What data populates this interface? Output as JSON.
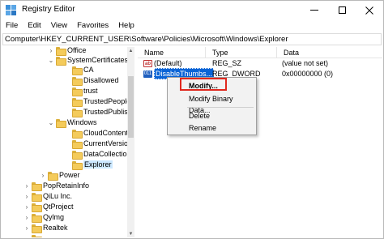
{
  "window": {
    "title": "Registry Editor",
    "icon": "registry-editor-icon"
  },
  "menu": [
    "File",
    "Edit",
    "View",
    "Favorites",
    "Help"
  ],
  "address": "Computer\\HKEY_CURRENT_USER\\Software\\Policies\\Microsoft\\Windows\\Explorer",
  "tree": [
    {
      "label": "Office",
      "chevron": ">"
    },
    {
      "label": "SystemCertificates",
      "chevron": "v"
    },
    {
      "label": "CA",
      "chevron": ""
    },
    {
      "label": "Disallowed",
      "chevron": ""
    },
    {
      "label": "trust",
      "chevron": ""
    },
    {
      "label": "TrustedPeople",
      "chevron": ""
    },
    {
      "label": "TrustedPublisher",
      "chevron": ""
    },
    {
      "label": "Windows",
      "chevron": "v"
    },
    {
      "label": "CloudContent",
      "chevron": ""
    },
    {
      "label": "CurrentVersion",
      "chevron": ""
    },
    {
      "label": "DataCollection",
      "chevron": ""
    },
    {
      "label": "Explorer",
      "chevron": ""
    },
    {
      "label": "Power",
      "chevron": ">"
    },
    {
      "label": "PopRetainInfo",
      "chevron": ">"
    },
    {
      "label": "QiLu Inc.",
      "chevron": ">"
    },
    {
      "label": "QtProject",
      "chevron": ">"
    },
    {
      "label": "Qylmg",
      "chevron": ">"
    },
    {
      "label": "Realtek",
      "chevron": ">"
    },
    {
      "label": "",
      "chevron": ">"
    }
  ],
  "columns": {
    "name": "Name",
    "type": "Type",
    "data": "Data"
  },
  "values": [
    {
      "name": "(Default)",
      "type": "REG_SZ",
      "data": "(value not set)",
      "icon": "string-value-icon"
    },
    {
      "name": "DisableThumbs...",
      "type": "REG_DWORD",
      "data": "0x00000000 (0)",
      "icon": "binary-value-icon"
    }
  ],
  "context_menu": {
    "modify": "Modify...",
    "modify_binary": "Modify Binary Data...",
    "delete": "Delete",
    "rename": "Rename"
  },
  "colors": {
    "selection": "#0a64d6",
    "highlight_box": "#e0281e",
    "folder": "#f4cb5b"
  }
}
